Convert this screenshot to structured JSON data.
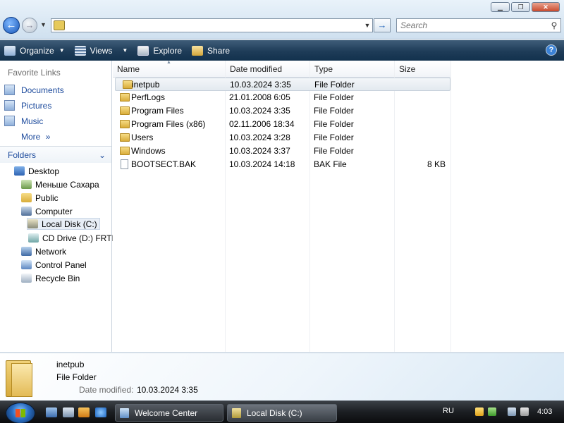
{
  "address": {
    "value": ""
  },
  "search": {
    "placeholder": "Search"
  },
  "window_buttons": {
    "minimize": "▁",
    "maximize": "❐",
    "close": "✕"
  },
  "toolbar": {
    "organize": "Organize",
    "views": "Views",
    "explore": "Explore",
    "share": "Share",
    "help": "?"
  },
  "favorites": {
    "title": "Favorite Links",
    "items": [
      "Documents",
      "Pictures",
      "Music"
    ],
    "more": "More",
    "more_arrow": "»"
  },
  "folders": {
    "title": "Folders",
    "tree": [
      "Desktop",
      "Меньше Сахара",
      "Public",
      "Computer",
      "Local Disk (C:)",
      "CD Drive (D:) FRTI",
      "Network",
      "Control Panel",
      "Recycle Bin"
    ]
  },
  "columns": {
    "name": "Name",
    "date": "Date modified",
    "type": "Type",
    "size": "Size"
  },
  "files": [
    {
      "name": "inetpub",
      "date": "10.03.2024 3:35",
      "type": "File Folder",
      "size": "",
      "kind": "folder"
    },
    {
      "name": "PerfLogs",
      "date": "21.01.2008 6:05",
      "type": "File Folder",
      "size": "",
      "kind": "folder"
    },
    {
      "name": "Program Files",
      "date": "10.03.2024 3:35",
      "type": "File Folder",
      "size": "",
      "kind": "folder"
    },
    {
      "name": "Program Files (x86)",
      "date": "02.11.2006 18:34",
      "type": "File Folder",
      "size": "",
      "kind": "folder"
    },
    {
      "name": "Users",
      "date": "10.03.2024 3:28",
      "type": "File Folder",
      "size": "",
      "kind": "folder"
    },
    {
      "name": "Windows",
      "date": "10.03.2024 3:37",
      "type": "File Folder",
      "size": "",
      "kind": "folder"
    },
    {
      "name": "BOOTSECT.BAK",
      "date": "10.03.2024 14:18",
      "type": "BAK File",
      "size": "8 KB",
      "kind": "file"
    }
  ],
  "details": {
    "name": "inetpub",
    "type": "File Folder",
    "modified_label": "Date modified:",
    "modified_value": "10.03.2024 3:35"
  },
  "taskbar": {
    "tasks": [
      "Welcome Center",
      "Local Disk (C:)"
    ],
    "lang": "RU",
    "time": "4:03"
  },
  "colors": {
    "link": "#1c4a9c",
    "command_bar": "#1e3c58",
    "folder": "#e3bb56",
    "taskbar": "#1b1e22"
  },
  "icons": {
    "back": "back-arrow-icon",
    "forward": "forward-arrow-icon",
    "go": "go-arrow-icon",
    "search": "search-icon",
    "folder": "folder-icon",
    "file": "file-icon",
    "start": "windows-start-icon"
  }
}
